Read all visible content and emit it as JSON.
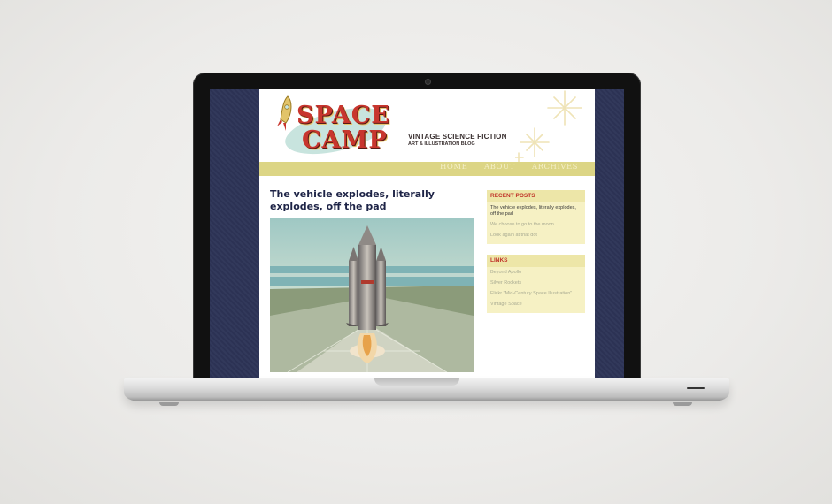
{
  "site": {
    "logo_line1": "SPACE",
    "logo_line2": "CAMP",
    "tagline_main": "VINTAGE SCIENCE FICTION",
    "tagline_sub": "ART & ILLUSTRATION BLOG",
    "nav": [
      "HOME",
      "ABOUT",
      "ARCHIVES"
    ],
    "colors": {
      "nav_bar": "#dcd585",
      "logo_red": "#c8362e",
      "title_navy": "#1d2346",
      "screen_bg": "#2d3457"
    }
  },
  "post": {
    "title": "The vehicle explodes, literally explodes, off the pad"
  },
  "sidebar": {
    "recent": {
      "heading": "RECENT POSTS",
      "items": [
        "The vehicle explodes, literally explodes, off the pad",
        "We choose to go to the moon",
        "Look again at that dot"
      ]
    },
    "links": {
      "heading": "LINKS",
      "items": [
        "Beyond Apollo",
        "Silver Rockets",
        "Flickr \"Mid-Century Space Illustration\"",
        "Vintage Space"
      ]
    }
  }
}
